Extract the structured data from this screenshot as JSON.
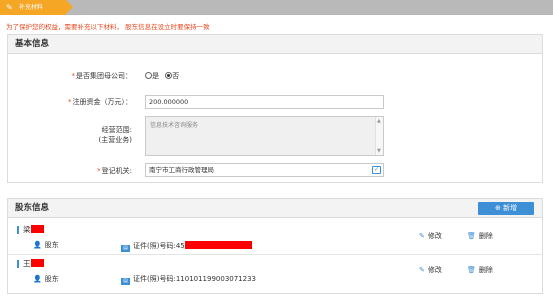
{
  "stepbar": {
    "step_icon": "pen-icon",
    "step_label": "补充材料"
  },
  "notice": "为了保护您的权益，需要补充以下材料，  股东信息在设立时要保持一致",
  "basic": {
    "title": "基本信息",
    "group_label": "是否集团母公司：",
    "group_options": [
      "是",
      "否"
    ],
    "group_selected": "否",
    "capital_label": "注册资金（万元）：",
    "capital_value": "200.000000",
    "scope_label_1": "经营范围:",
    "scope_label_2": "(主营业务)",
    "scope_value": "信息技术咨询服务",
    "authority_label": "登记机关:",
    "authority_value": "南宁市工商行政管理局"
  },
  "shareholders": {
    "title": "股东信息",
    "add_label": "新增",
    "rows": [
      {
        "name": "梁",
        "role": "股东",
        "cert_label": "证件(照)号码:",
        "cert_no": "45",
        "edit": "修改",
        "delete": "删除"
      },
      {
        "name": "王",
        "role": "股东",
        "cert_label": "证件(照)号码:",
        "cert_no": "110101199003071233",
        "edit": "修改",
        "delete": "删除"
      }
    ]
  },
  "colors": {
    "accent": "#f4a624",
    "primary": "#3d8fd6",
    "required": "#e8481f",
    "redaction": "#ff0000"
  }
}
